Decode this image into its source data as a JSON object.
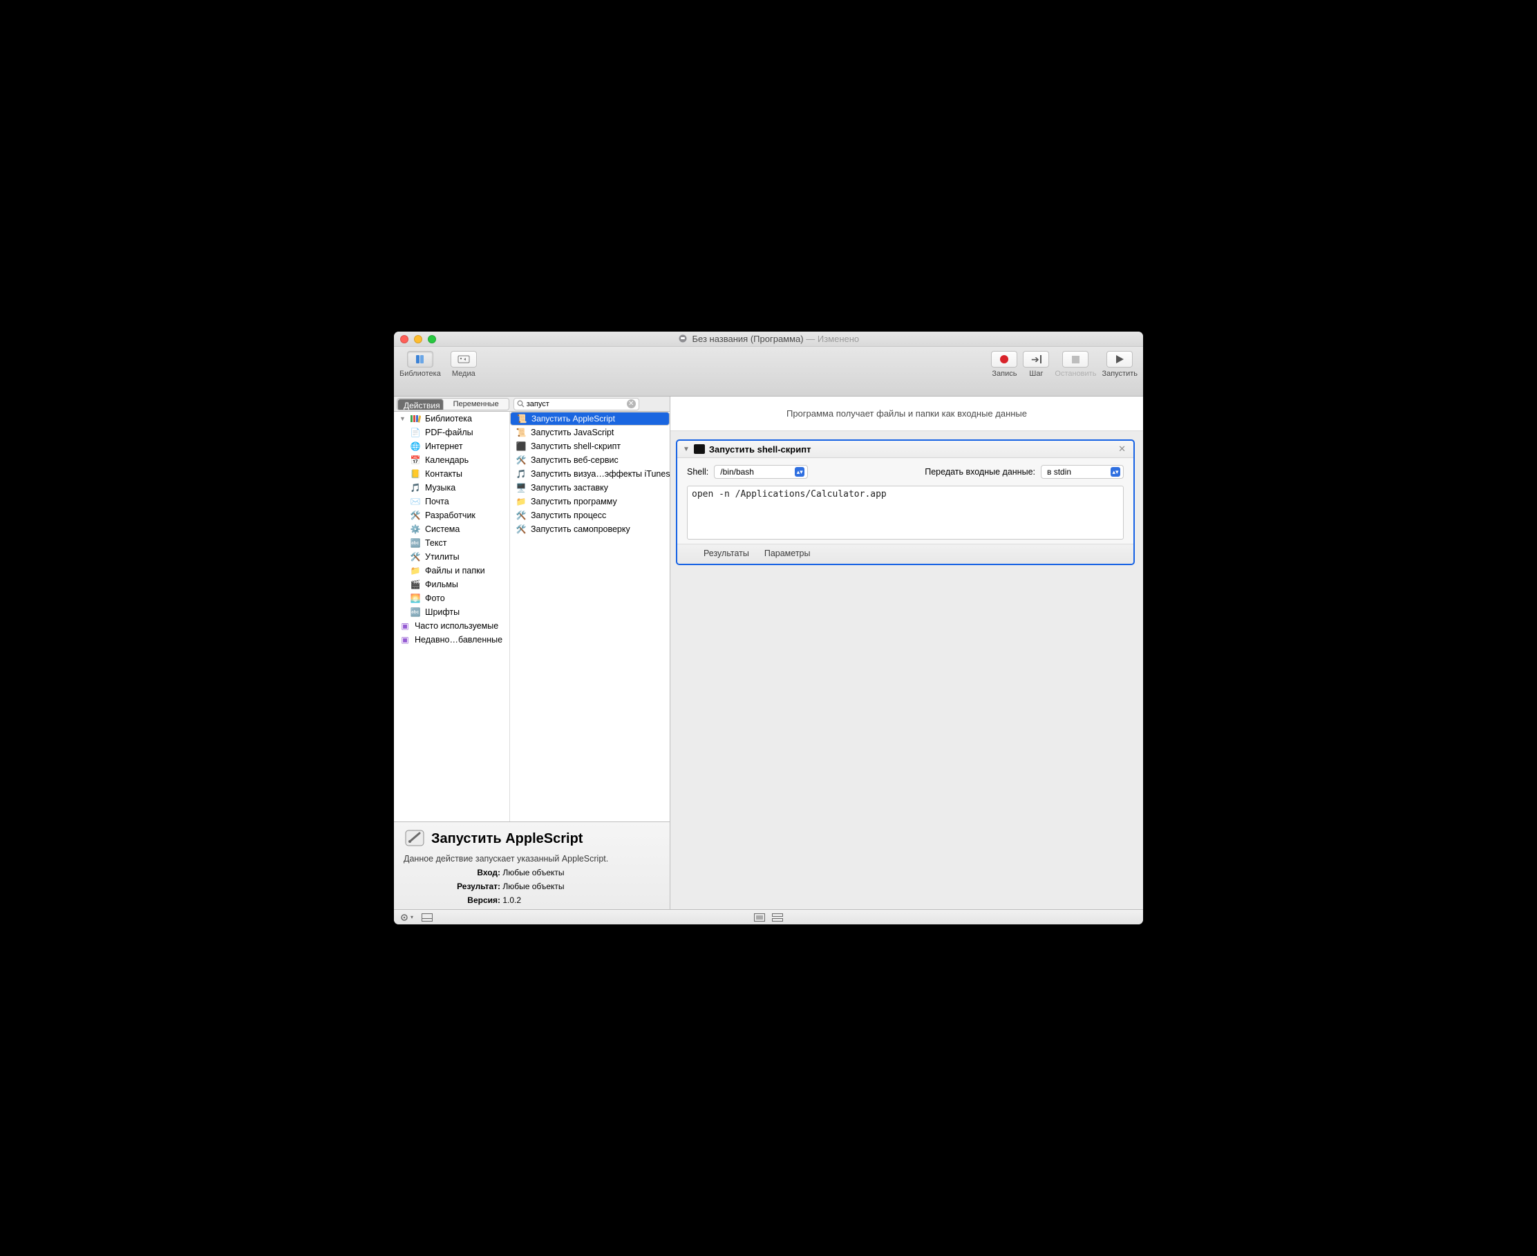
{
  "window": {
    "title_main": "Без названия (Программа)",
    "title_mod": "— Изменено"
  },
  "toolbar": {
    "library": "Библиотека",
    "media": "Медиа",
    "record": "Запись",
    "step": "Шаг",
    "stop": "Остановить",
    "run": "Запустить"
  },
  "tabs": {
    "actions": "Действия",
    "variables": "Переменные"
  },
  "search": {
    "query": "запуст"
  },
  "sidebar": {
    "root": "Библиотека",
    "items": [
      "PDF-файлы",
      "Интернет",
      "Календарь",
      "Контакты",
      "Музыка",
      "Почта",
      "Разработчик",
      "Система",
      "Текст",
      "Утилиты",
      "Файлы и папки",
      "Фильмы",
      "Фото",
      "Шрифты"
    ],
    "smart": [
      "Часто используемые",
      "Недавно…бавленные"
    ]
  },
  "actions": [
    "Запустить AppleScript",
    "Запустить JavaScript",
    "Запустить shell-скрипт",
    "Запустить веб-сервис",
    "Запустить визуа…эффекты iTunes",
    "Запустить заставку",
    "Запустить программу",
    "Запустить процесс",
    "Запустить самопроверку"
  ],
  "detail": {
    "title": "Запустить AppleScript",
    "desc": "Данное действие запускает указанный AppleScript.",
    "input_k": "Вход:",
    "input_v": "Любые объекты",
    "result_k": "Результат:",
    "result_v": "Любые объекты",
    "version_k": "Версия:",
    "version_v": "1.0.2"
  },
  "canvas": {
    "header": "Программа получает файлы и папки как входные данные",
    "card": {
      "title": "Запустить shell-скрипт",
      "shell_lbl": "Shell:",
      "shell_val": "/bin/bash",
      "pass_lbl": "Передать входные данные:",
      "pass_val": "в stdin",
      "code": "open -n /Applications/Calculator.app",
      "results": "Результаты",
      "params": "Параметры"
    }
  }
}
